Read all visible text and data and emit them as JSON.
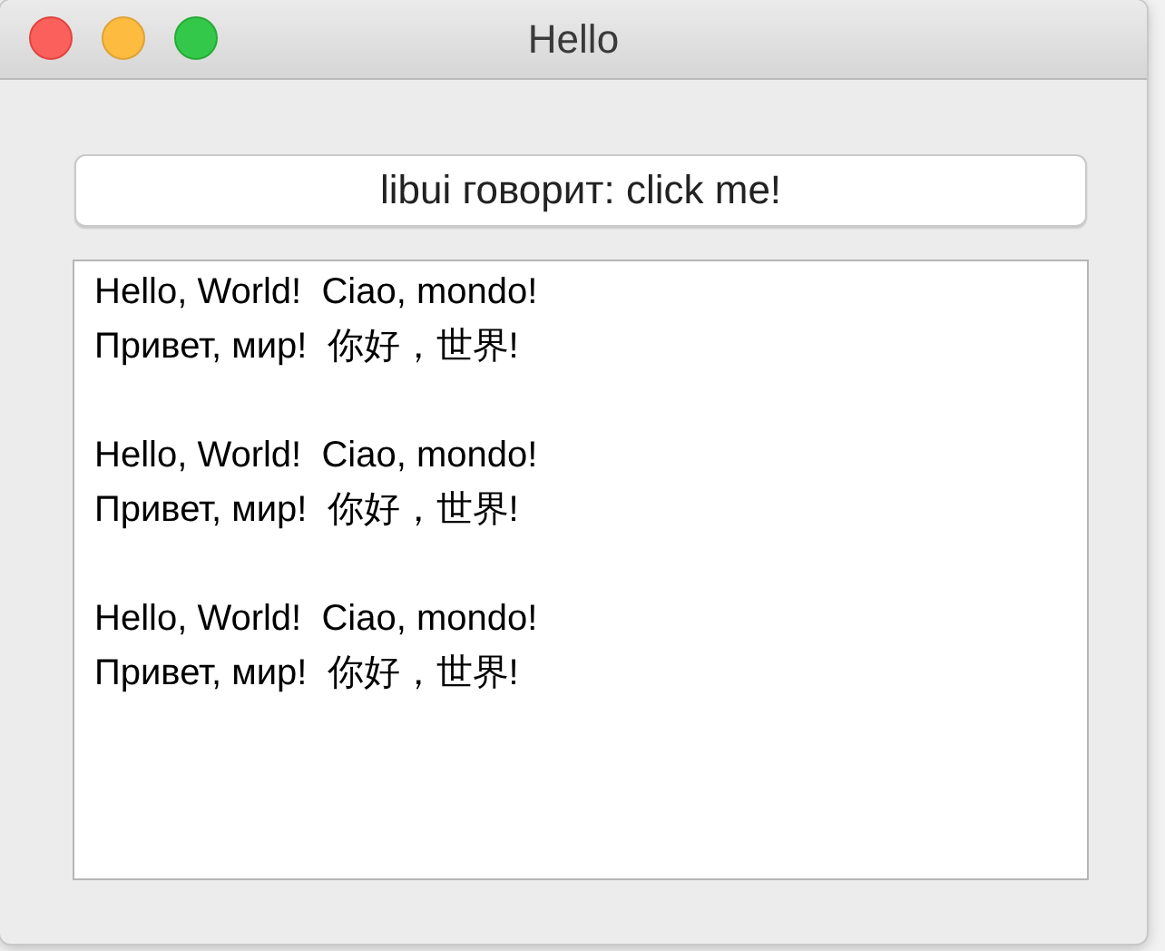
{
  "window": {
    "title": "Hello"
  },
  "button": {
    "label": "libui говорит: click me!"
  },
  "text_area": {
    "paragraphs": [
      {
        "lines": [
          "Hello, World!  Ciao, mondo!",
          "Привет, мир!  你好，世界!"
        ]
      },
      {
        "lines": [
          "Hello, World!  Ciao, mondo!",
          "Привет, мир!  你好，世界!"
        ]
      },
      {
        "lines": [
          "Hello, World!  Ciao, mondo!",
          "Привет, мир!  你好，世界!"
        ]
      }
    ]
  }
}
